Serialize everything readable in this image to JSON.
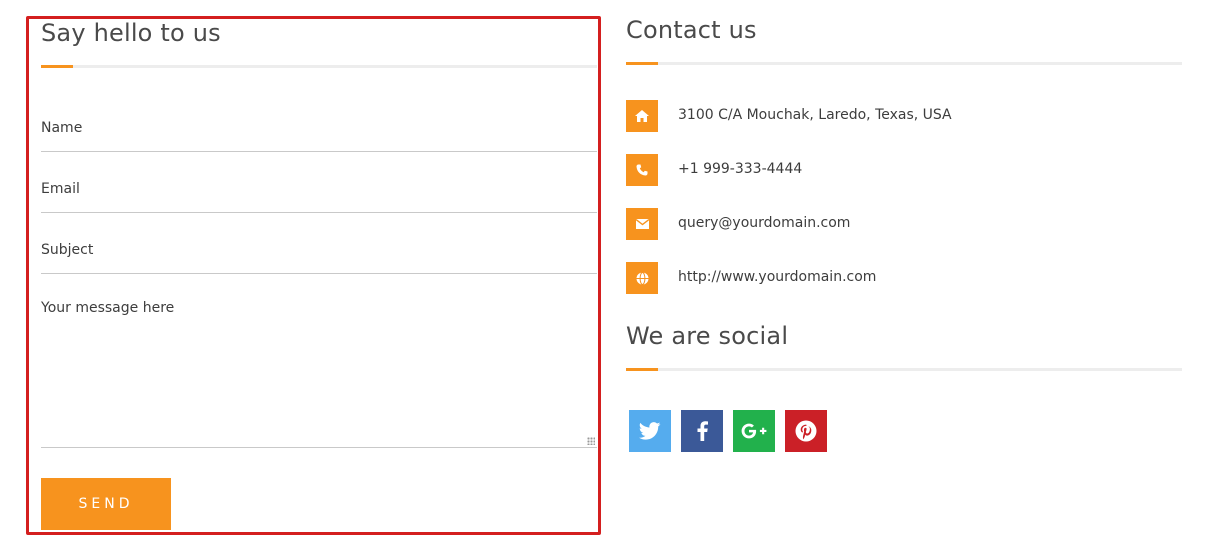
{
  "form": {
    "title": "Say hello to us",
    "name_placeholder": "Name",
    "email_placeholder": "Email",
    "subject_placeholder": "Subject",
    "message_placeholder": "Your message here",
    "send_label": "SEND"
  },
  "contact": {
    "title": "Contact us",
    "items": [
      {
        "icon": "home-icon",
        "text": "3100 C/A Mouchak, Laredo, Texas, USA"
      },
      {
        "icon": "phone-icon",
        "text": "+1 999-333-4444"
      },
      {
        "icon": "envelope-icon",
        "text": "query@yourdomain.com"
      },
      {
        "icon": "globe-icon",
        "text": "http://www.yourdomain.com"
      }
    ]
  },
  "social": {
    "title": "We are social",
    "links": [
      {
        "name": "twitter-icon",
        "color": "#55acee"
      },
      {
        "name": "facebook-icon",
        "color": "#3b5998"
      },
      {
        "name": "google-plus-icon",
        "color": "#22b14c"
      },
      {
        "name": "pinterest-icon",
        "color": "#cb2027"
      }
    ]
  },
  "colors": {
    "accent": "#f7931e",
    "highlight_border": "#d41f1f"
  }
}
